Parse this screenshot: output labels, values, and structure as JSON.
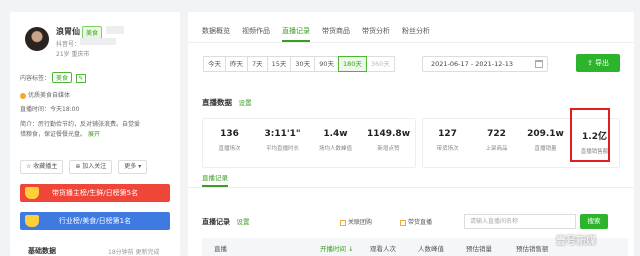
{
  "profile": {
    "name": "浪胃仙",
    "category_tag": "美食",
    "account_label": "抖音号：",
    "meta": "21岁  重庆市",
    "content_tag_label": "内容标签：",
    "content_tag": "美食",
    "verified": "优质美食自媒体",
    "live_time": "直播时间：今天18:00",
    "intro_line1": "简介：厉行勤俭节约，反对铺张浪费。自觉爱",
    "intro_line2": "惜粮食，保证餐餐光盘。",
    "intro_more": "展开",
    "collect_btn": "收藏播主",
    "follow_btn": "加入关注",
    "more_btn": "更多",
    "rank1": "带货播主榜/生鲜/日榜第5名",
    "rank2": "行业榜/美食/日榜第1名",
    "base_title": "基础数据",
    "base_time": "18分钟前  更新完成"
  },
  "tabs": [
    "数据概览",
    "视频作品",
    "直播记录",
    "带货商品",
    "带货分析",
    "粉丝分析"
  ],
  "active_tab": 2,
  "ranges": [
    "今天",
    "昨天",
    "7天",
    "15天",
    "30天",
    "90天",
    "180天",
    "360天"
  ],
  "active_range": 6,
  "date_range": "2021-06-17  -  2021-12-13",
  "export_label": "导出",
  "live_data": {
    "title": "直播数据",
    "settings": "设置",
    "left_stats": [
      {
        "value": "136",
        "label": "直播场次"
      },
      {
        "value": "3:11'1\"",
        "label": "平均直播时长"
      },
      {
        "value": "1.4w",
        "label": "场均人数峰值"
      },
      {
        "value": "1149.8w",
        "label": "新增点赞"
      }
    ],
    "right_stats": [
      {
        "value": "127",
        "label": "带货场次"
      },
      {
        "value": "722",
        "label": "上架商品"
      },
      {
        "value": "209.1w",
        "label": "直播销量"
      },
      {
        "value": "1.2亿",
        "label": "直播销售额"
      }
    ]
  },
  "subtab": "直播记录",
  "records": {
    "title": "直播记录",
    "settings": "设置",
    "filter1": "关联团购",
    "filter2": "带货直播",
    "search_placeholder": "请输入直播间名称",
    "search_btn": "搜索",
    "columns": [
      "直播",
      "开播时间 ↓",
      "观看人次",
      "人数峰值",
      "预估销量",
      "预估销售额"
    ]
  },
  "watermark": "壹号新媒"
}
